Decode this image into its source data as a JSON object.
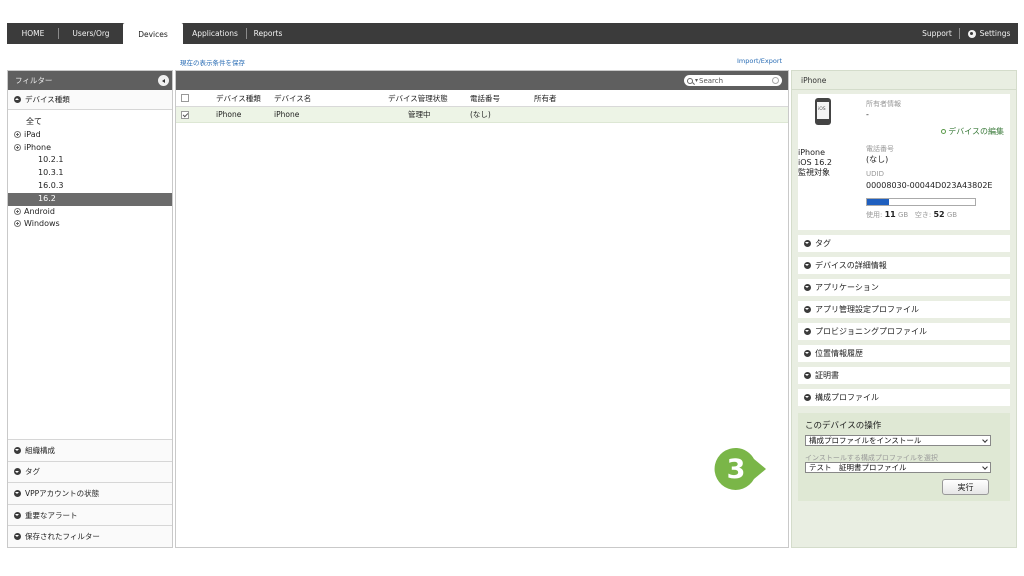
{
  "nav": {
    "tabs": [
      {
        "label": "HOME"
      },
      {
        "label": "Users/Org"
      },
      {
        "label": "Devices"
      },
      {
        "label": "Applications"
      },
      {
        "label": "Reports"
      }
    ],
    "support": "Support",
    "settings": "Settings"
  },
  "links": {
    "save_conditions": "現在の表示条件を保存",
    "import_export": "Import/Export"
  },
  "filter": {
    "title": "フィルター",
    "device_type_header": "デバイス種類",
    "tree": [
      {
        "label": "全て"
      },
      {
        "label": "iPad"
      },
      {
        "label": "iPhone"
      },
      {
        "label": "10.2.1"
      },
      {
        "label": "10.3.1"
      },
      {
        "label": "16.0.3"
      },
      {
        "label": "16.2"
      },
      {
        "label": "Android"
      },
      {
        "label": "Windows"
      }
    ],
    "bottom_sections": [
      {
        "label": "組織構成"
      },
      {
        "label": "タグ"
      },
      {
        "label": "VPPアカウントの状態"
      },
      {
        "label": "重要なアラート"
      },
      {
        "label": "保存されたフィルター"
      }
    ]
  },
  "device_list": {
    "search_placeholder": "Search",
    "columns": [
      "デバイス種類",
      "デバイス名",
      "デバイス管理状態",
      "電話番号",
      "所有者"
    ],
    "rows": [
      {
        "type": "iPhone",
        "name": "iPhone",
        "status": "管理中",
        "phone": "(なし)",
        "owner": ""
      }
    ]
  },
  "detail": {
    "title": "iPhone",
    "device_name": "iPhone",
    "os": "iOS 16.2",
    "supervised": "監視対象",
    "owner_label": "所有者情報",
    "owner_value": "-",
    "edit_link": "デバイスの編集",
    "phone_label": "電話番号",
    "phone_value": "(なし)",
    "udid_label": "UDID",
    "udid_value": "00008030-00044D023A43802E",
    "storage": {
      "used_label": "使用:",
      "used": "11",
      "free_label": "空き:",
      "free": "52",
      "unit": "GB",
      "used_fraction": 0.2
    },
    "sections": [
      {
        "label": "タグ"
      },
      {
        "label": "デバイスの詳細情報"
      },
      {
        "label": "アプリケーション"
      },
      {
        "label": "アプリ管理設定プロファイル"
      },
      {
        "label": "プロビジョニングプロファイル"
      },
      {
        "label": "位置情報履歴"
      },
      {
        "label": "証明書"
      },
      {
        "label": "構成プロファイル"
      }
    ],
    "operations": {
      "title": "このデバイスの操作",
      "action_select": "構成プロファイルをインストール",
      "profile_hint": "インストールする構成プロファイルを選択",
      "profile_select": "テスト　証明書プロファイル",
      "execute": "実行"
    }
  },
  "badge": {
    "number": "3",
    "color": "#7ab648"
  }
}
